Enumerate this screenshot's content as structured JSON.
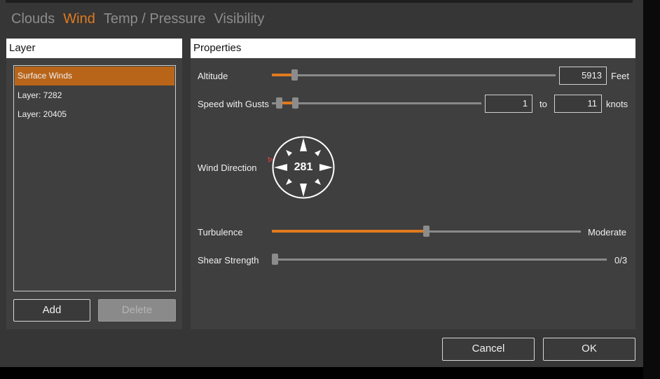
{
  "tabs": [
    {
      "label": "Clouds",
      "active": false
    },
    {
      "label": "Wind",
      "active": true
    },
    {
      "label": "Temp / Pressure",
      "active": false
    },
    {
      "label": "Visibility",
      "active": false
    }
  ],
  "layer_panel": {
    "title": "Layer",
    "items": [
      "Surface Winds",
      "Layer: 7282",
      "Layer: 20405"
    ],
    "selected": "Surface Winds",
    "add_label": "Add",
    "delete_label": "Delete"
  },
  "properties": {
    "title": "Properties",
    "altitude": {
      "label": "Altitude",
      "value": "5913",
      "unit": "Feet",
      "slider_fraction": 0.07
    },
    "speed": {
      "label": "Speed with Gusts",
      "from": "1",
      "to_label": "to",
      "to": "11",
      "unit": "knots",
      "low_fraction": 0.02,
      "high_fraction": 0.1
    },
    "wind_direction": {
      "label": "Wind Direction",
      "value": "281"
    },
    "turbulence": {
      "label": "Turbulence",
      "value": "Moderate",
      "slider_fraction": 0.5
    },
    "shear": {
      "label": "Shear Strength",
      "value": "0/3",
      "slider_fraction": 0
    }
  },
  "footer": {
    "cancel_label": "Cancel",
    "ok_label": "OK"
  },
  "colors": {
    "accent": "#e07a1f",
    "selected_row": "#b8651a"
  }
}
